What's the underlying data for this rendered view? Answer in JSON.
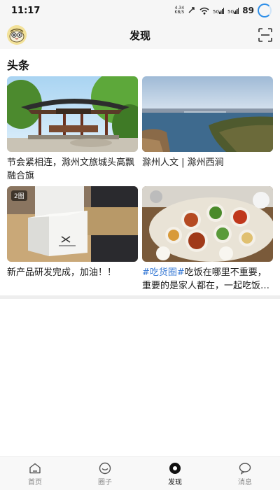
{
  "status_bar": {
    "time": "11:17",
    "net_speed_value": "4.34",
    "net_speed_unit": "KB/S",
    "battery": "89"
  },
  "header": {
    "title": "发现"
  },
  "section": {
    "title": "头条"
  },
  "cards": [
    {
      "caption": "节会紧相连，滁州文旅城头高飘融合旗",
      "badge": ""
    },
    {
      "caption": "滁州人文 | 滁州西涧",
      "badge": ""
    },
    {
      "caption": "新产品研发完成，加油！！",
      "badge": "2图"
    },
    {
      "hashtag": "#吃货圈#",
      "caption": "吃饭在哪里不重要，重要的是家人都在，一起吃饭才香",
      "badge": ""
    }
  ],
  "bottom_nav": {
    "items": [
      {
        "label": "首页",
        "icon": "home-icon"
      },
      {
        "label": "圈子",
        "icon": "circle-icon"
      },
      {
        "label": "发现",
        "icon": "discover-icon",
        "active": true
      },
      {
        "label": "消息",
        "icon": "message-icon"
      }
    ]
  },
  "colors": {
    "accent_link": "#3a7bd5",
    "loading_ring": "#2f8fe8",
    "header_bg": "#f6f6f6"
  }
}
